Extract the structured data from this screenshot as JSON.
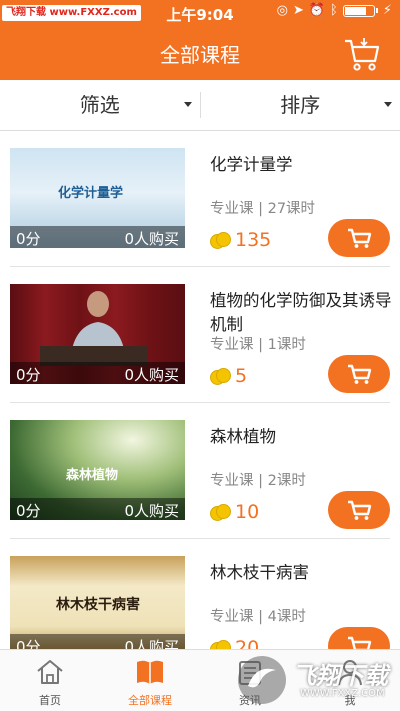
{
  "status_bar": {
    "watermark": "飞翔下载 www.FXXZ.com",
    "time": "上午9:04",
    "battery_level": 0.75
  },
  "header": {
    "title": "全部课程",
    "cart_icon": "shopping-cart-icon"
  },
  "filters": {
    "filter_label": "筛选",
    "sort_label": "排序"
  },
  "courses": [
    {
      "title": "化学计量学",
      "meta": "专业课 | 27课时",
      "price": "135",
      "score": "0分",
      "buyers": "0人购买",
      "thumb_caption": "化学计量学"
    },
    {
      "title": "植物的化学防御及其诱导机制",
      "meta": "专业课 | 1课时",
      "price": "5",
      "score": "0分",
      "buyers": "0人购买",
      "thumb_caption": ""
    },
    {
      "title": "森林植物",
      "meta": "专业课 | 2课时",
      "price": "10",
      "score": "0分",
      "buyers": "0人购买",
      "thumb_caption": "森林植物"
    },
    {
      "title": "林木枝干病害",
      "meta": "专业课 | 4课时",
      "price": "20",
      "score": "0分",
      "buyers": "0人购买",
      "thumb_caption": "林木枝干病害"
    }
  ],
  "tabbar": {
    "home": "首页",
    "all_courses": "全部课程",
    "news": "资讯",
    "me": "我"
  },
  "brand_watermark": {
    "text": "飞翔下载",
    "url": "WWW.FXXZ.COM"
  },
  "colors": {
    "accent": "#f37222",
    "coin": "#f5c400"
  }
}
